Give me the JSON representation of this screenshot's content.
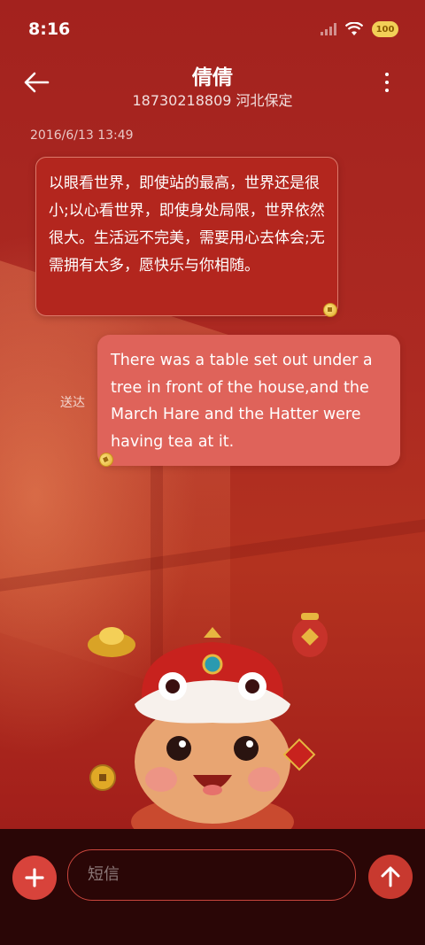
{
  "status_bar": {
    "time": "8:16",
    "battery": "100",
    "icons": [
      "signal-icon",
      "wifi-icon",
      "battery-icon"
    ]
  },
  "header": {
    "contact_name": "倩倩",
    "contact_subtitle": "18730218809 河北保定",
    "icons": [
      "back-arrow-icon",
      "more-vertical-icon"
    ]
  },
  "conversation": {
    "timestamp": "2016/6/13 13:49",
    "incoming": {
      "text": "以眼看世界，即使站的最高，世界还是很小;以心看世界，即使身处局限，世界依然很大。生活远不完美，需要用心去体会;无需拥有太多，愿快乐与你相随。"
    },
    "outgoing": {
      "text": "There was a table set out under a tree in front of the house,and the March Hare and the Hatter were having tea at it.",
      "status": "送达"
    }
  },
  "composer": {
    "placeholder": "短信",
    "icons": [
      "plus-icon",
      "send-arrow-up-icon"
    ]
  },
  "colors": {
    "background": "#a8201d",
    "bubble_incoming": "#b3261e",
    "bubble_outgoing": "#df635a",
    "accent": "#d8433b",
    "bottom_bar": "#2a0606"
  }
}
